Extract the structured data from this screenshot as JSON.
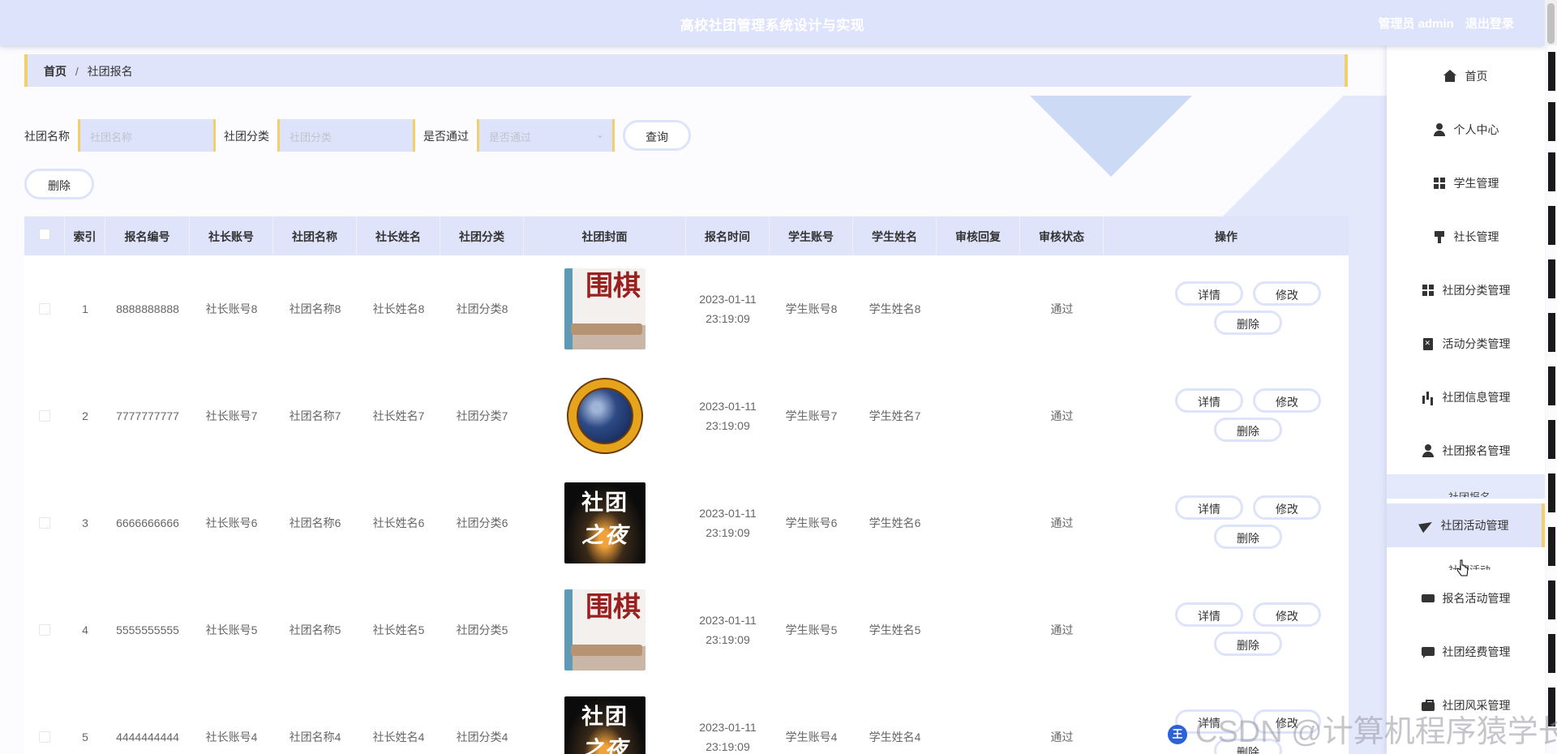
{
  "header": {
    "title": "高校社团管理系统设计与实现",
    "role": "管理员 admin",
    "logout": "退出登录"
  },
  "breadcrumb": {
    "home": "首页",
    "separator": "/",
    "current": "社团报名"
  },
  "search": {
    "club_name_label": "社团名称",
    "club_name_placeholder": "社团名称",
    "club_category_label": "社团分类",
    "club_category_placeholder": "社团分类",
    "passed_label": "是否通过",
    "passed_placeholder": "是否通过",
    "query_button": "查询",
    "delete_button": "删除"
  },
  "table": {
    "headers": [
      "索引",
      "报名编号",
      "社长账号",
      "社团名称",
      "社长姓名",
      "社团分类",
      "社团封面",
      "报名时间",
      "学生账号",
      "学生姓名",
      "审核回复",
      "审核状态",
      "操作"
    ],
    "rows": [
      {
        "index": "1",
        "reg_no": "8888888888",
        "leader_account": "社长账号8",
        "club_name": "社团名称8",
        "leader_name": "社长姓名8",
        "category": "社团分类8",
        "cover": "weiqi",
        "time_date": "2023-01-11",
        "time_clock": "23:19:09",
        "student_account": "学生账号8",
        "student_name": "学生姓名8",
        "reply": "",
        "status": "通过"
      },
      {
        "index": "2",
        "reg_no": "7777777777",
        "leader_account": "社长账号7",
        "club_name": "社团名称7",
        "leader_name": "社长姓名7",
        "category": "社团分类7",
        "cover": "astronomy",
        "time_date": "2023-01-11",
        "time_clock": "23:19:09",
        "student_account": "学生账号7",
        "student_name": "学生姓名7",
        "reply": "",
        "status": "通过"
      },
      {
        "index": "3",
        "reg_no": "6666666666",
        "leader_account": "社长账号6",
        "club_name": "社团名称6",
        "leader_name": "社长姓名6",
        "category": "社团分类6",
        "cover": "night",
        "time_date": "2023-01-11",
        "time_clock": "23:19:09",
        "student_account": "学生账号6",
        "student_name": "学生姓名6",
        "reply": "",
        "status": "通过"
      },
      {
        "index": "4",
        "reg_no": "5555555555",
        "leader_account": "社长账号5",
        "club_name": "社团名称5",
        "leader_name": "社长姓名5",
        "category": "社团分类5",
        "cover": "weiqi",
        "time_date": "2023-01-11",
        "time_clock": "23:19:09",
        "student_account": "学生账号5",
        "student_name": "学生姓名5",
        "reply": "",
        "status": "通过"
      },
      {
        "index": "5",
        "reg_no": "4444444444",
        "leader_account": "社长账号4",
        "club_name": "社团名称4",
        "leader_name": "社长姓名4",
        "category": "社团分类4",
        "cover": "night",
        "time_date": "2023-01-11",
        "time_clock": "23:19:09",
        "student_account": "学生账号4",
        "student_name": "学生姓名4",
        "reply": "",
        "status": "通过"
      }
    ],
    "op_detail": "详情",
    "op_edit": "修改",
    "op_delete": "删除"
  },
  "cover_text": {
    "weiqi": "围棋",
    "night_line1": "社团",
    "night_line2": "之夜"
  },
  "sidebar": {
    "items": [
      {
        "label": "首页",
        "icon": "home-icon"
      },
      {
        "label": "个人中心",
        "icon": "user-icon"
      },
      {
        "label": "学生管理",
        "icon": "grid-icon"
      },
      {
        "label": "社长管理",
        "icon": "chair-icon"
      },
      {
        "label": "社团分类管理",
        "icon": "grid-icon"
      },
      {
        "label": "活动分类管理",
        "icon": "clipboard-icon"
      },
      {
        "label": "社团信息管理",
        "icon": "bar-chart-icon"
      },
      {
        "label": "社团报名管理",
        "icon": "user-icon"
      },
      {
        "label": "社团活动管理",
        "icon": "paper-plane-icon"
      },
      {
        "label": "报名活动管理",
        "icon": "ticket-icon"
      },
      {
        "label": "社团经费管理",
        "icon": "chat-icon"
      },
      {
        "label": "社团风采管理",
        "icon": "briefcase-icon"
      }
    ],
    "sub_club_registration": "社团报名",
    "sub_club_activity": "社团活动"
  },
  "watermark": {
    "text": "CSDN @计算机程序猿学长",
    "ime_badge": "王"
  },
  "colors": {
    "header_bg": "#dde3fb",
    "accent_yellow": "#f1cf6a",
    "table_head_bg": "#dfe4fb"
  }
}
